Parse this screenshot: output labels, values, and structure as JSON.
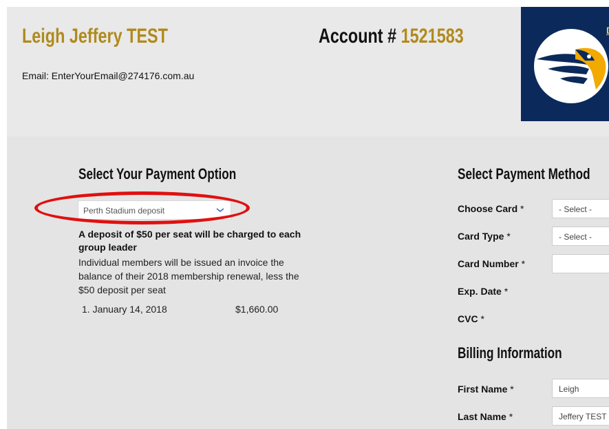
{
  "header": {
    "member_name": "Leigh Jeffery TEST",
    "account_label": "Account #",
    "account_number": "1521583",
    "email": "Email: EnterYourEmail@274176.com.au",
    "logo_link_text": "D"
  },
  "payment_option": {
    "title": "Select Your Payment Option",
    "selected": "Perth Stadium deposit",
    "deposit_notice": "A deposit of $50 per seat will be charged to each group leader",
    "deposit_detail": "Individual members will be issued an invoice the balance of their 2018 membership renewal, less the $50 deposit per seat",
    "instalments": [
      {
        "label": "1. January 14, 2018",
        "amount": "$1,660.00"
      }
    ]
  },
  "payment_method": {
    "title": "Select Payment Method",
    "choose_card": {
      "label": "Choose Card",
      "value": "- Select -"
    },
    "card_type": {
      "label": "Card Type",
      "value": "- Select -"
    },
    "card_number": {
      "label": "Card Number",
      "value": ""
    },
    "exp_date": {
      "label": "Exp. Date"
    },
    "cvc": {
      "label": "CVC"
    },
    "required_marker": "*"
  },
  "billing": {
    "title": "Billing Information",
    "first_name": {
      "label": "First Name",
      "value": "Leigh"
    },
    "last_name": {
      "label": "Last Name",
      "value": "Jeffery TEST"
    }
  },
  "colors": {
    "gold": "#b08a1d",
    "navy": "#0b2a5b",
    "highlight_red": "#e01010",
    "background": "#e4e4e4"
  },
  "icons": {
    "dropdown": "chevron-down-icon",
    "logo": "eagle-logo-icon"
  }
}
